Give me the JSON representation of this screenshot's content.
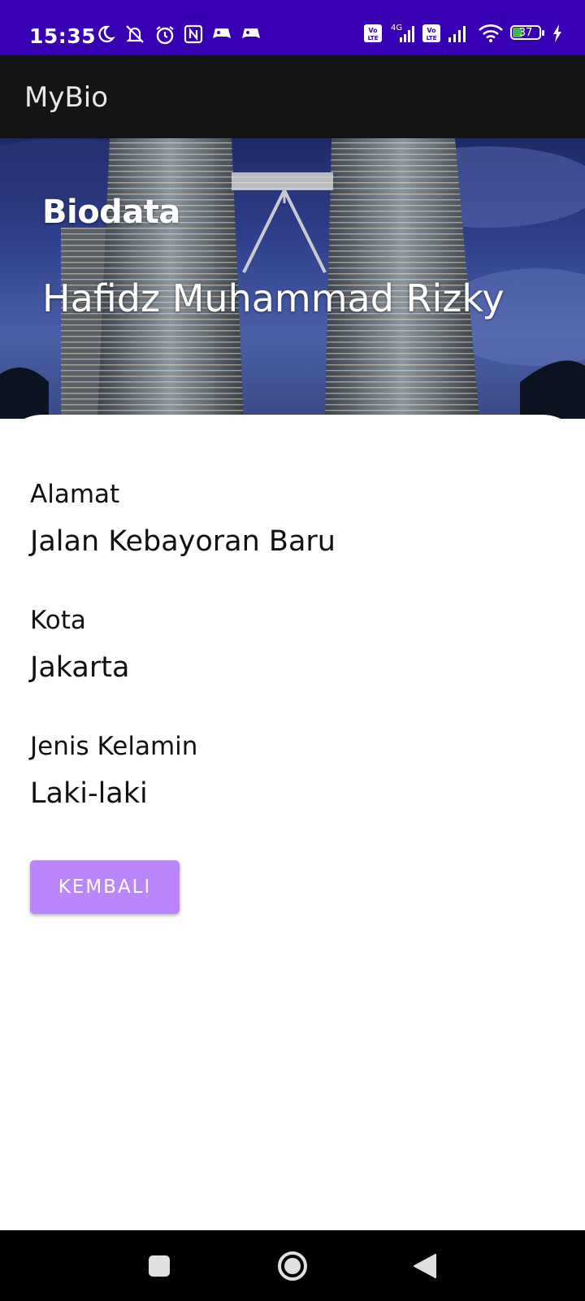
{
  "status_bar": {
    "time": "15:35",
    "battery": "37",
    "network": "4G",
    "icons": [
      "moon-icon",
      "mute-icon",
      "alarm-icon",
      "nfc-icon",
      "game-icon",
      "game-icon",
      "volte-icon",
      "signal-icon",
      "volte-icon",
      "signal-icon",
      "wifi-icon",
      "battery-icon",
      "charging-icon"
    ]
  },
  "app_bar": {
    "title": "MyBio"
  },
  "header": {
    "heading": "Biodata",
    "name": "Hafidz Muhammad Rizky"
  },
  "fields": [
    {
      "label": "Alamat",
      "value": "Jalan Kebayoran Baru"
    },
    {
      "label": "Kota",
      "value": "Jakarta"
    },
    {
      "label": "Jenis Kelamin",
      "value": "Laki-laki"
    }
  ],
  "back_button": {
    "label": "KEMBALI"
  },
  "nav_bar": {
    "buttons": [
      "recents-icon",
      "home-icon",
      "back-icon"
    ]
  },
  "colors": {
    "status_bar": "#3700B3",
    "app_bar": "#141414",
    "button": "#BB86FC"
  }
}
